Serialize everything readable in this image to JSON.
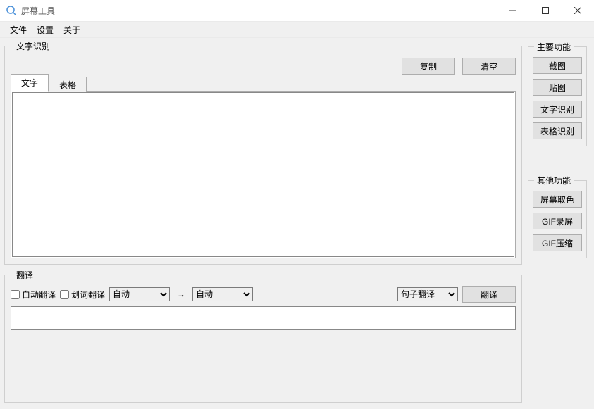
{
  "window": {
    "title": "屏幕工具"
  },
  "menubar": {
    "file": "文件",
    "settings": "设置",
    "about": "关于"
  },
  "ocr": {
    "legend": "文字识别",
    "copy_label": "复制",
    "clear_label": "清空",
    "tab_text": "文字",
    "tab_table": "表格",
    "text_value": ""
  },
  "translate": {
    "legend": "翻译",
    "auto_checkbox_label": "自动翻译",
    "select_checkbox_label": "划词翻译",
    "auto_checked": false,
    "select_checked": false,
    "source_lang_options": [
      "自动"
    ],
    "source_lang_value": "自动",
    "target_lang_options": [
      "自动"
    ],
    "target_lang_value": "自动",
    "arrow": "→",
    "mode_options": [
      "句子翻译"
    ],
    "mode_value": "句子翻译",
    "button_label": "翻译",
    "result_value": ""
  },
  "side": {
    "main_legend": "主要功能",
    "screenshot": "截图",
    "pin_image": "贴图",
    "ocr_text": "文字识别",
    "ocr_table": "表格识别",
    "other_legend": "其他功能",
    "color_picker": "屏幕取色",
    "gif_record": "GIF录屏",
    "gif_compress": "GIF压缩"
  }
}
